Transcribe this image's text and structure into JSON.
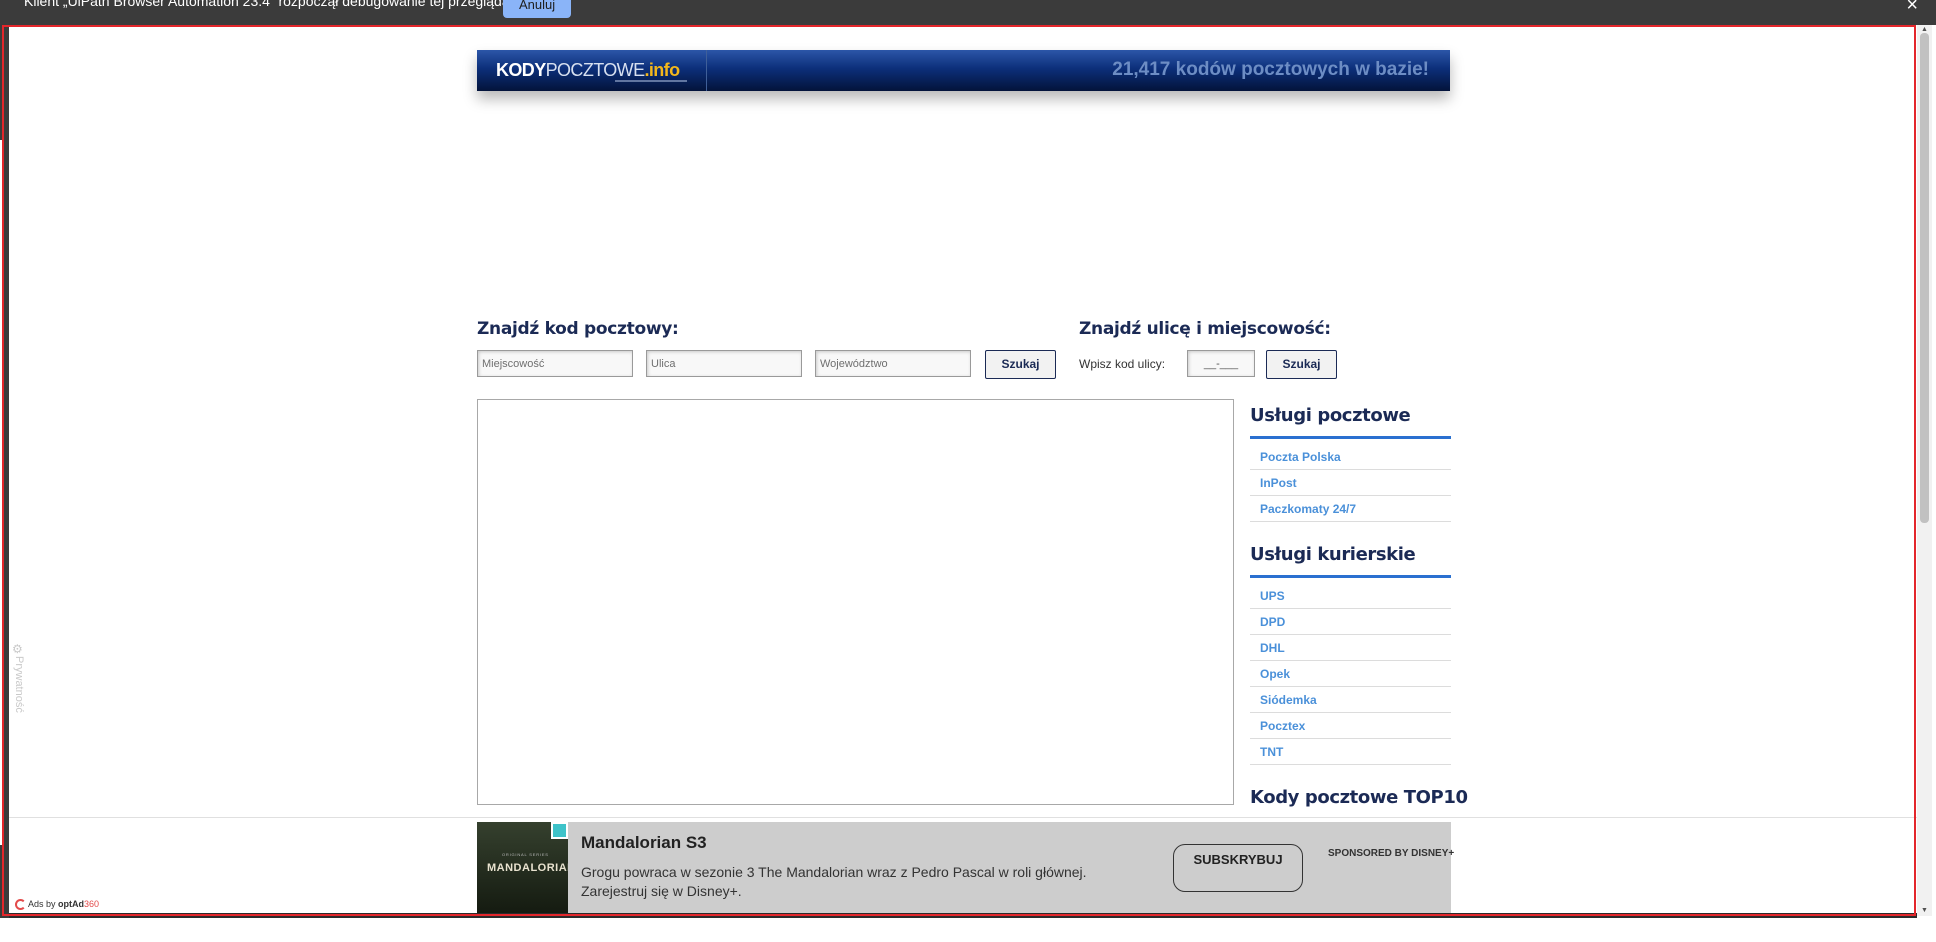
{
  "infobar": {
    "message": "Klient „UiPath Browser Automation 23.4” rozpoczął debugowanie tej przeglądarki",
    "cancel_label": "Anuluj",
    "close_icon": "×"
  },
  "header": {
    "logo": {
      "part1": "KODY",
      "part2": "POCZTOWE",
      "dot": ".",
      "part3": "info"
    },
    "counter_text": "21,417 kodów pocztowych w bazie!"
  },
  "search_code": {
    "heading": "Znajdź kod pocztowy:",
    "city_placeholder": "Miejscowość",
    "street_placeholder": "Ulica",
    "voivodeship_placeholder": "Województwo",
    "button_label": "Szukaj"
  },
  "search_street": {
    "heading": "Znajdź ulicę i miejscowość:",
    "label": "Wpisz kod ulicy:",
    "code_value": "__-___",
    "button_label": "Szukaj"
  },
  "sidebar": {
    "postal": {
      "heading": "Usługi pocztowe",
      "items": [
        "Poczta Polska",
        "InPost",
        "Paczkomaty 24/7"
      ]
    },
    "courier": {
      "heading": "Usługi kurierskie",
      "items": [
        "UPS",
        "DPD",
        "DHL",
        "Opek",
        "Siódemka",
        "Pocztex",
        "TNT"
      ]
    },
    "top10": {
      "heading": "Kody pocztowe TOP10"
    }
  },
  "privacy": {
    "label": "Prywatność",
    "icon": "gear-icon"
  },
  "ad": {
    "thumb_small": "ORIGINAL SERIES",
    "thumb_title": "MANDALORIAN",
    "title": "Mandalorian S3",
    "description": "Grogu powraca w sezonie 3 The Mandalorian wraz z Pedro Pascal w roli głównej. Zarejestruj się w Disney+.",
    "cta": "SUBSKRYBUJ",
    "sponsor": "SPONSORED BY DISNEY+",
    "ads_by": "Ads by",
    "brand": "optAd",
    "brand_num": "360"
  },
  "colors": {
    "accent_blue": "#2a70d0",
    "link_blue": "#4a90d9",
    "navy": "#1b2a55",
    "logo_yellow": "#f3b71b",
    "highlight_red": "#e3262b"
  }
}
